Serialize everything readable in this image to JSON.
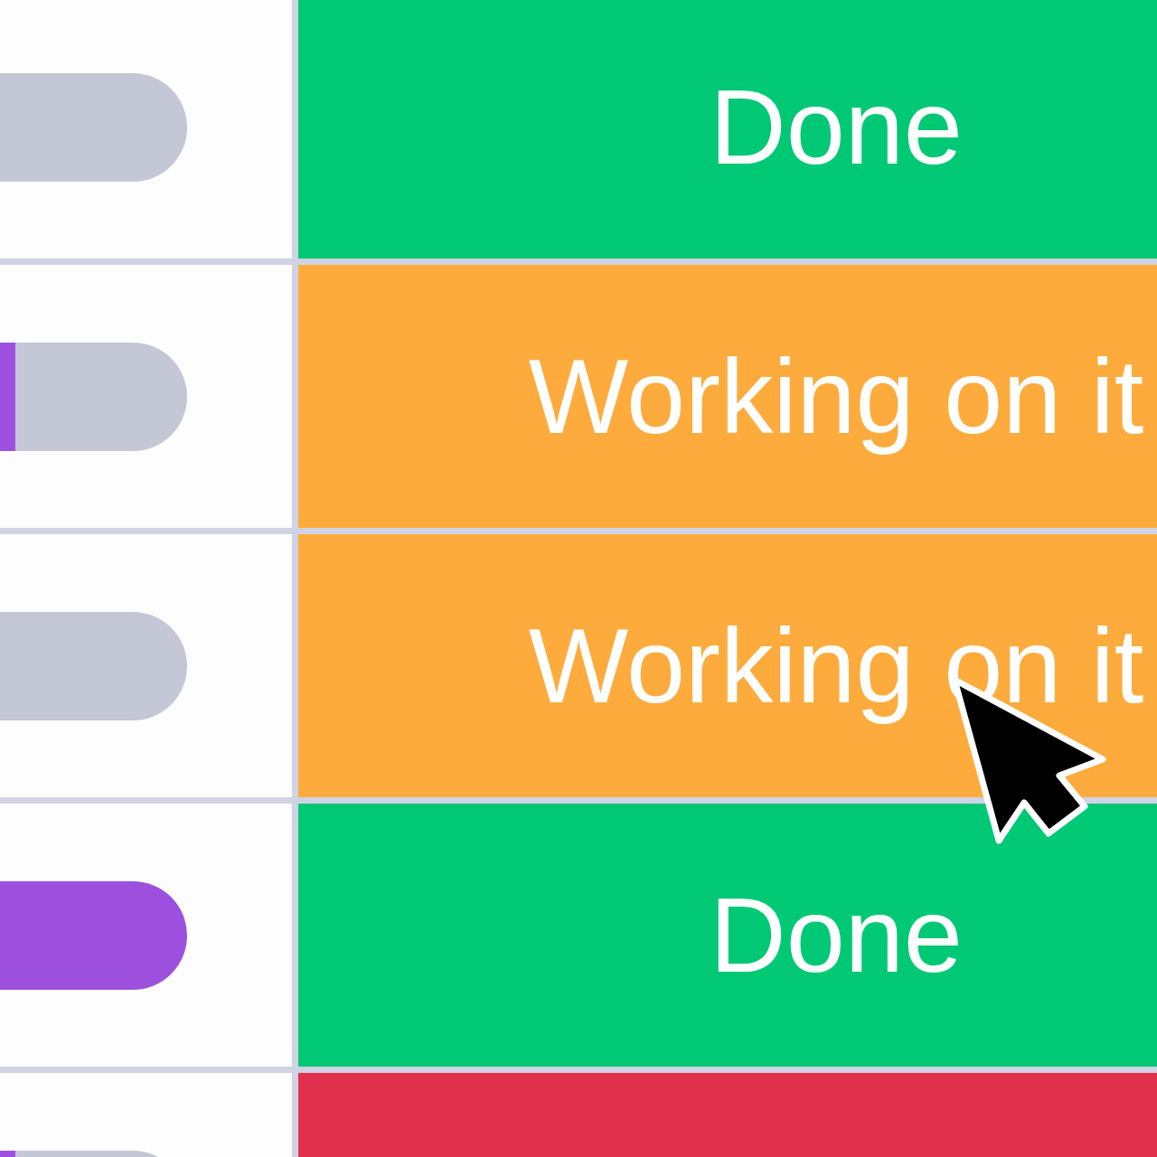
{
  "rows": [
    {
      "timeline": {
        "level": 0
      },
      "status": {
        "label": "Done",
        "color": "#00c875"
      }
    },
    {
      "timeline": {
        "level": 0.08
      },
      "status": {
        "label": "Working on it",
        "color": "#fdab3d"
      }
    },
    {
      "timeline": {
        "level": 0
      },
      "status": {
        "label": "Working on it",
        "color": "#fdab3d"
      }
    },
    {
      "timeline": {
        "level": 1
      },
      "status": {
        "label": "Done",
        "color": "#00c875"
      }
    },
    {
      "timeline": {
        "level": 0.08
      },
      "status": {
        "color": "#e0304c"
      }
    }
  ]
}
